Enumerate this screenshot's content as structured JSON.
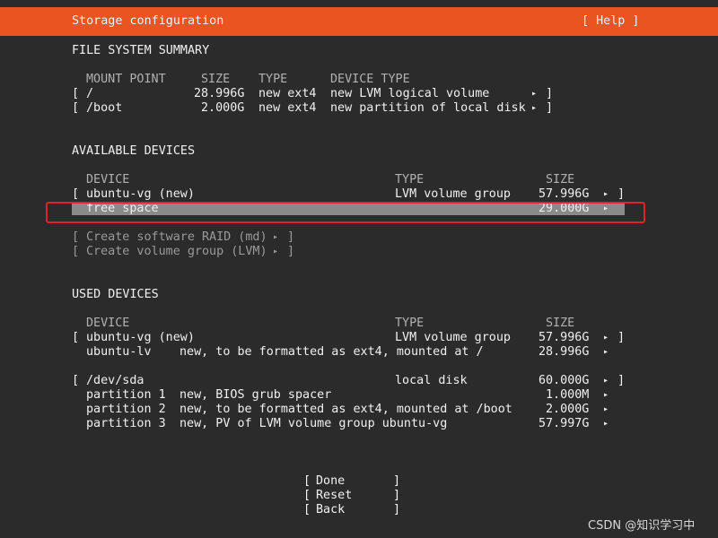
{
  "header": {
    "title": "Storage configuration",
    "help": "[ Help ]",
    "bar_color": "#e95420"
  },
  "fs_summary": {
    "heading": "FILE SYSTEM SUMMARY",
    "columns": {
      "mount": "MOUNT POINT",
      "size": "SIZE",
      "type": "TYPE",
      "device_type": "DEVICE TYPE"
    },
    "rows": [
      {
        "open": "[",
        "mount": "/",
        "size": "28.996G",
        "type": "new ext4",
        "device_type": "new LVM logical volume",
        "arrow": "▸",
        "close": "]"
      },
      {
        "open": "[",
        "mount": "/boot",
        "size": "2.000G",
        "type": "new ext4",
        "device_type": "new partition of local disk",
        "arrow": "▸",
        "close": "]"
      }
    ]
  },
  "available": {
    "heading": "AVAILABLE DEVICES",
    "columns": {
      "device": "DEVICE",
      "type": "TYPE",
      "size": "SIZE"
    },
    "rows": [
      {
        "open": "[",
        "device": "ubuntu-vg (new)",
        "type": "LVM volume group",
        "size": "57.996G",
        "arrow": "▸",
        "close": "]"
      },
      {
        "device": "free space",
        "size": "29.000G",
        "arrow": "▸"
      }
    ],
    "actions": [
      {
        "open": "[",
        "label": "Create software RAID (md)",
        "arrow": "▸",
        "close": "]"
      },
      {
        "open": "[",
        "label": "Create volume group (LVM)",
        "arrow": "▸",
        "close": "]"
      }
    ]
  },
  "used": {
    "heading": "USED DEVICES",
    "columns": {
      "device": "DEVICE",
      "type": "TYPE",
      "size": "SIZE"
    },
    "rows": [
      {
        "open": "[",
        "device": "ubuntu-vg (new)",
        "desc": "",
        "type": "LVM volume group",
        "size": "57.996G",
        "arrow": "▸",
        "close": "]"
      },
      {
        "open": "",
        "device": "ubuntu-lv",
        "desc": "new, to be formatted as ext4, mounted at /",
        "type": "",
        "size": "28.996G",
        "arrow": "▸",
        "close": ""
      },
      {
        "open": "[",
        "device": "/dev/sda",
        "desc": "",
        "type": "local disk",
        "size": "60.000G",
        "arrow": "▸",
        "close": "]"
      },
      {
        "open": "",
        "device": "partition 1",
        "desc": "new, BIOS grub spacer",
        "type": "",
        "size": "1.000M",
        "arrow": "▸",
        "close": ""
      },
      {
        "open": "",
        "device": "partition 2",
        "desc": "new, to be formatted as ext4, mounted at /boot",
        "type": "",
        "size": "2.000G",
        "arrow": "▸",
        "close": ""
      },
      {
        "open": "",
        "device": "partition 3",
        "desc": "new, PV of LVM volume group ubuntu-vg",
        "type": "",
        "size": "57.997G",
        "arrow": "▸",
        "close": ""
      }
    ]
  },
  "buttons": {
    "done": "Done",
    "reset": "Reset",
    "back": "Back",
    "open": "[",
    "close": "]"
  },
  "watermark": "CSDN @知识学习中",
  "colors": {
    "background": "#2b2b2b",
    "highlight": "#8a8a8a",
    "annotation_box": "#e0222a",
    "text": "#f0f0f0"
  }
}
